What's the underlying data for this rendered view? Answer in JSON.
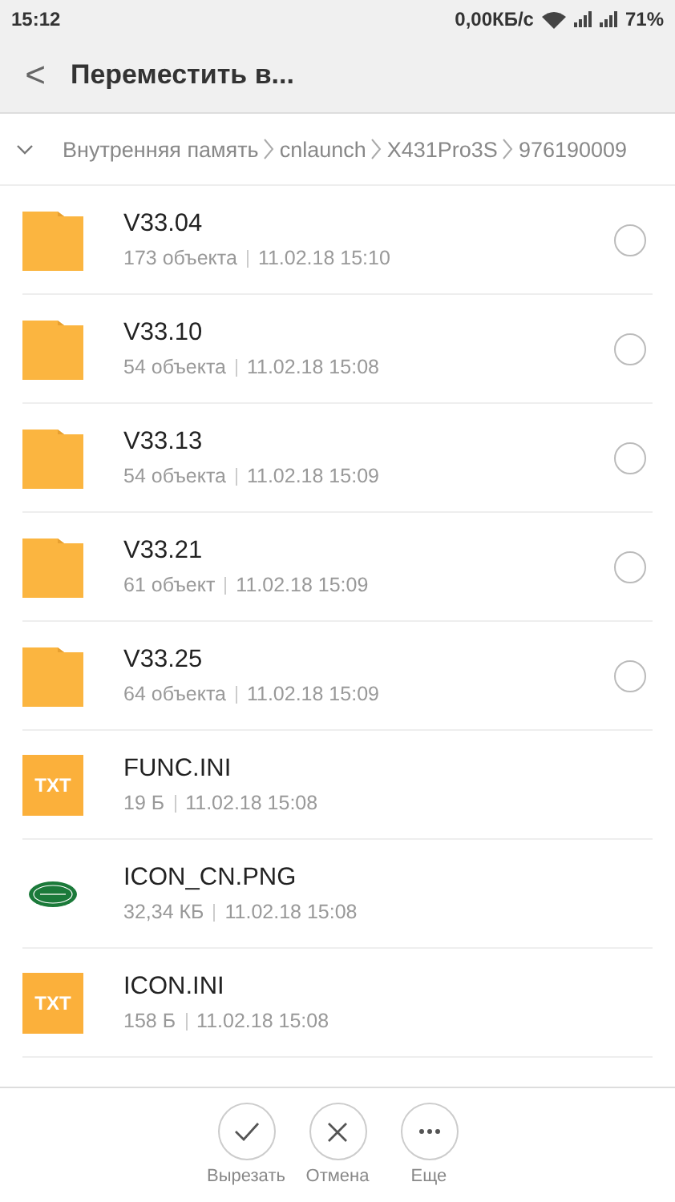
{
  "status_bar": {
    "time": "15:12",
    "speed": "0,00КБ/с",
    "battery": "71%"
  },
  "header": {
    "back": "<",
    "title": "Переместить в..."
  },
  "breadcrumb": [
    "Внутренняя память",
    "cnlaunch",
    "X431Pro3S",
    "976190009"
  ],
  "items": [
    {
      "kind": "folder",
      "name": "V33.04",
      "size": "173 объекта",
      "date": "11.02.18 15:10",
      "selected": false
    },
    {
      "kind": "folder",
      "name": "V33.10",
      "size": "54 объекта",
      "date": "11.02.18 15:08",
      "selected": false
    },
    {
      "kind": "folder",
      "name": "V33.13",
      "size": "54 объекта",
      "date": "11.02.18 15:09",
      "selected": false
    },
    {
      "kind": "folder",
      "name": "V33.21",
      "size": "61 объект",
      "date": "11.02.18 15:09",
      "selected": false
    },
    {
      "kind": "folder",
      "name": "V33.25",
      "size": "64 объекта",
      "date": "11.02.18 15:09",
      "selected": false
    },
    {
      "kind": "txt",
      "icon_label": "TXT",
      "name": "FUNC.INI",
      "size": "19 Б",
      "date": "11.02.18 15:08"
    },
    {
      "name": "ICON_CN.PNG",
      "size": "32,34 КБ",
      "date": "11.02.18 15:08"
    },
    {
      "kind": "txt",
      "icon_label": "TXT",
      "name": "ICON.INI",
      "size": "158 Б",
      "date": "11.02.18 15:08"
    }
  ],
  "actions": [
    {
      "kind": "check",
      "label": "Вырезать"
    },
    {
      "kind": "close",
      "label": "Отмена"
    },
    {
      "kind": "more",
      "label": "Еще"
    }
  ]
}
